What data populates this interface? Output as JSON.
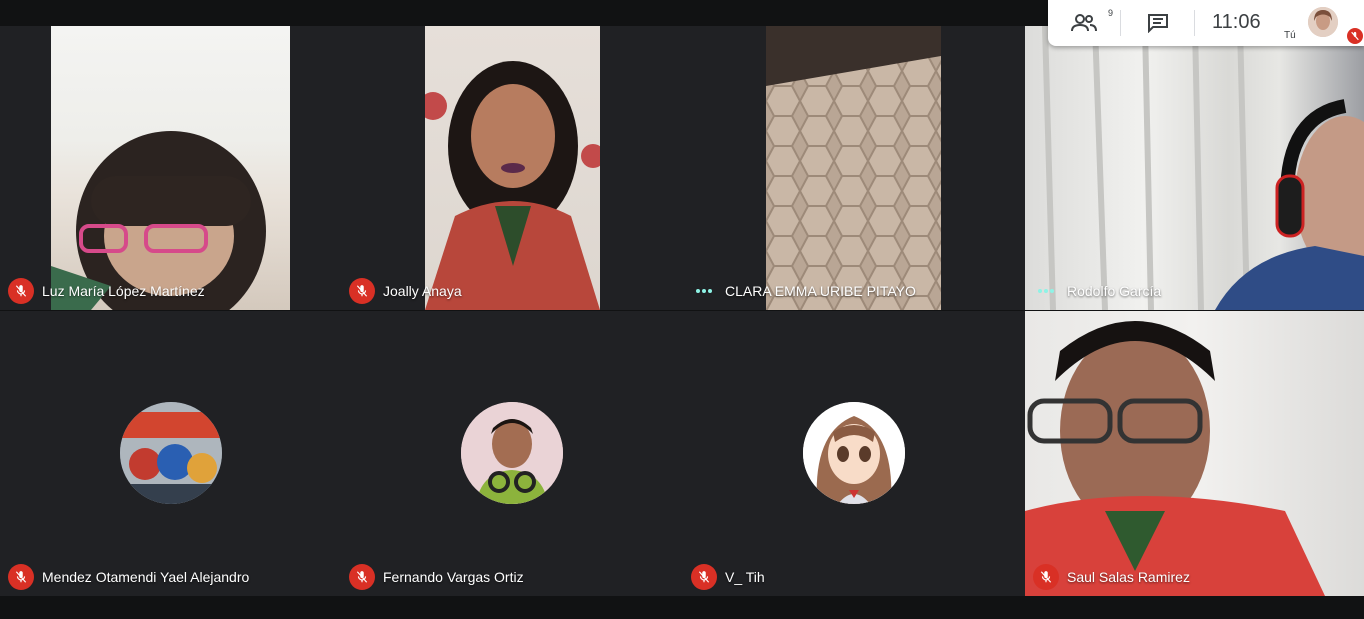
{
  "meeting": {
    "clock": "11:06",
    "participants_count": "9",
    "self_label": "Tú"
  },
  "colors": {
    "tile_bg": "#202124",
    "mic_off": "#d93025",
    "speaking_dots": "#8ef3e6"
  },
  "icons": {
    "people": "people-icon",
    "chat": "chat-icon",
    "mic_off": "mic-off-icon",
    "dots": "speaking-dots-icon"
  },
  "tiles": [
    {
      "name": "Luz María López Martínez",
      "status": "muted",
      "kind": "video"
    },
    {
      "name": "Joally Anaya",
      "status": "muted",
      "kind": "video"
    },
    {
      "name": "CLARA EMMA URIBE PITAYO",
      "status": "active",
      "kind": "video"
    },
    {
      "name": "Rodolfo García",
      "status": "active",
      "kind": "video"
    },
    {
      "name": "Mendez Otamendi Yael Alejandro",
      "status": "muted",
      "kind": "avatar"
    },
    {
      "name": "Fernando Vargas Ortiz",
      "status": "muted",
      "kind": "avatar"
    },
    {
      "name": "V_ Tih",
      "status": "muted",
      "kind": "avatar"
    },
    {
      "name": "Saul Salas Ramirez",
      "status": "muted",
      "kind": "video"
    }
  ]
}
